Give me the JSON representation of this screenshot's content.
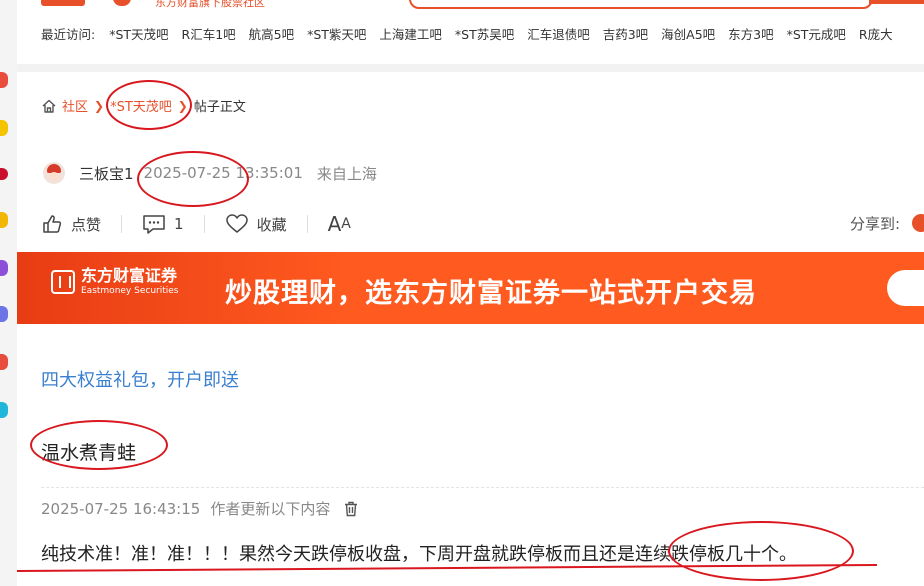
{
  "top_header": {
    "site_subtitle": "东方财富旗下股票社区",
    "recent_label": "最近访问:",
    "recent_items": [
      "*ST天茂吧",
      "R汇车1吧",
      "航高5吧",
      "*ST紫天吧",
      "上海建工吧",
      "*ST苏吴吧",
      "汇车退债吧",
      "吉药3吧",
      "海创A5吧",
      "东方3吧",
      "*ST元成吧",
      "R庞大"
    ]
  },
  "breadcrumb": {
    "home": "社区",
    "bar": "*ST天茂吧",
    "current": "帖子正文"
  },
  "post": {
    "author": "三板宝1",
    "datetime": "2025-07-25 13:35:01",
    "location": "来自上海",
    "title": "温水煮青蛙",
    "update_time": "2025-07-25 16:43:15",
    "update_note": "作者更新以下内容",
    "content": "纯技术准！准！准！！！果然今天跌停板收盘，下周开盘就跌停板而且还是连续跌停板几十个。"
  },
  "actions": {
    "like": "点赞",
    "comment_count": "1",
    "favorite": "收藏",
    "font_big": "A",
    "font_small": "A",
    "share_label": "分享到:"
  },
  "banner": {
    "brand_cn": "东方财富证券",
    "brand_en": "Eastmoney Securities",
    "slogan": "炒股理财，选东方财富证券一站式开户交易"
  },
  "promo_link": "四大权益礼包，开户即送",
  "colors": {
    "accent": "#e8502a",
    "link_blue": "#3a7fd0",
    "annotation_red": "#d9171e"
  }
}
